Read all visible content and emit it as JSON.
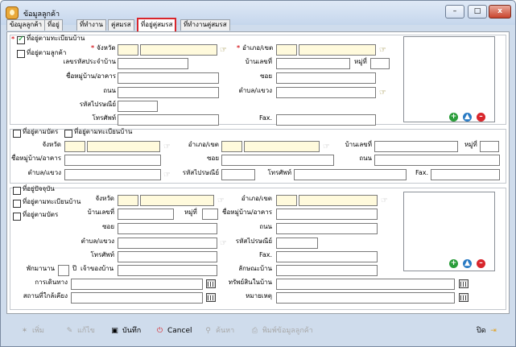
{
  "window": {
    "title": "ข้อมูลลูกค้า",
    "minimize": "–",
    "maximize": "□",
    "close": "x"
  },
  "tabs": [
    {
      "label": "ข้อมูลลูกค้า"
    },
    {
      "label": "ที่อยู่"
    },
    {
      "label": "ที่ทำงาน"
    },
    {
      "label": "คู่สมรส"
    },
    {
      "label": "ที่อยู่คู่สมรส"
    },
    {
      "label": "ที่ทำงานคู่สมรส"
    }
  ],
  "section1": {
    "same_as_house_label": "ที่อยู่ตามทะเบียนบ้าน",
    "same_as_customer_label": "ที่อยู่ตามลูกค้า",
    "province_label": "จังหวัด",
    "district_label": "อำเภอ/เขต",
    "house_code_label": "เลขรหัสประจำบ้าน",
    "house_no_label": "บ้านเลขที่",
    "moo_label": "หมู่ที่",
    "village_label": "ชื่อหมู่บ้าน/อาคาร",
    "soi_label": "ซอย",
    "road_label": "ถนน",
    "subdistrict_label": "ตำบล/แขวง",
    "postcode_label": "รหัสไปรษณีย์",
    "phone_label": "โทรศัพท์",
    "fax_label": "Fax."
  },
  "section2": {
    "id_card_label": "ที่อยู่ตามบัตร",
    "house_reg_label": "ที่อยู่ตามทะเบียนบ้าน",
    "province_label": "จังหวัด",
    "district_label": "อำเภอ/เขต",
    "house_no_label": "บ้านเลขที่",
    "moo_label": "หมู่ที่",
    "village_label": "ชื่อหมู่บ้าน/อาคาร",
    "soi_label": "ซอย",
    "road_label": "ถนน",
    "subdistrict_label": "ตำบล/แขวง",
    "postcode_label": "รหัสไปรษณีย์",
    "phone_label": "โทรศัพท์",
    "fax_label": "Fax."
  },
  "section3": {
    "current_label": "ที่อยู่ปัจจุบัน",
    "house_reg_label": "ที่อยู่ตามทะเบียนบ้าน",
    "id_card_label": "ที่อยู่ตามบัตร",
    "province_label": "จังหวัด",
    "district_label": "อำเภอ/เขต",
    "house_no_label": "บ้านเลขที่",
    "moo_label": "หมู่ที่",
    "village_label": "ชื่อหมู่บ้าน/อาคาร",
    "soi_label": "ซอย",
    "road_label": "ถนน",
    "subdistrict_label": "ตำบล/แขวง",
    "postcode_label": "รหัสไปรษณีย์",
    "phone_label": "โทรศัพท์",
    "fax_label": "Fax.",
    "stay_label": "พักมานาน",
    "year_label": "ปี",
    "owner_label": "เจ้าของบ้าน",
    "house_type_label": "ลักษณะบ้าน",
    "travel_label": "การเดินทาง",
    "property_label": "ทรัพย์สินในบ้าน",
    "nearby_label": "สถานที่ใกล้เคียง",
    "note_label": "หมายเหตุ"
  },
  "toolbar": {
    "add": "เพิ่ม",
    "edit": "แก้ไข",
    "save": "บันทึก",
    "cancel": "Cancel",
    "search": "ค้นหา",
    "print": "พิมพ์ข้อมูลลูกค้า",
    "close": "ปิด"
  },
  "colors": {
    "active_tab_border": "#d8262c",
    "required": "#d8262c",
    "lookup_field": "#fffadc",
    "add_photo": "#2a9d3a",
    "up_photo": "#2a7bc4",
    "remove_photo": "#d8262c"
  }
}
